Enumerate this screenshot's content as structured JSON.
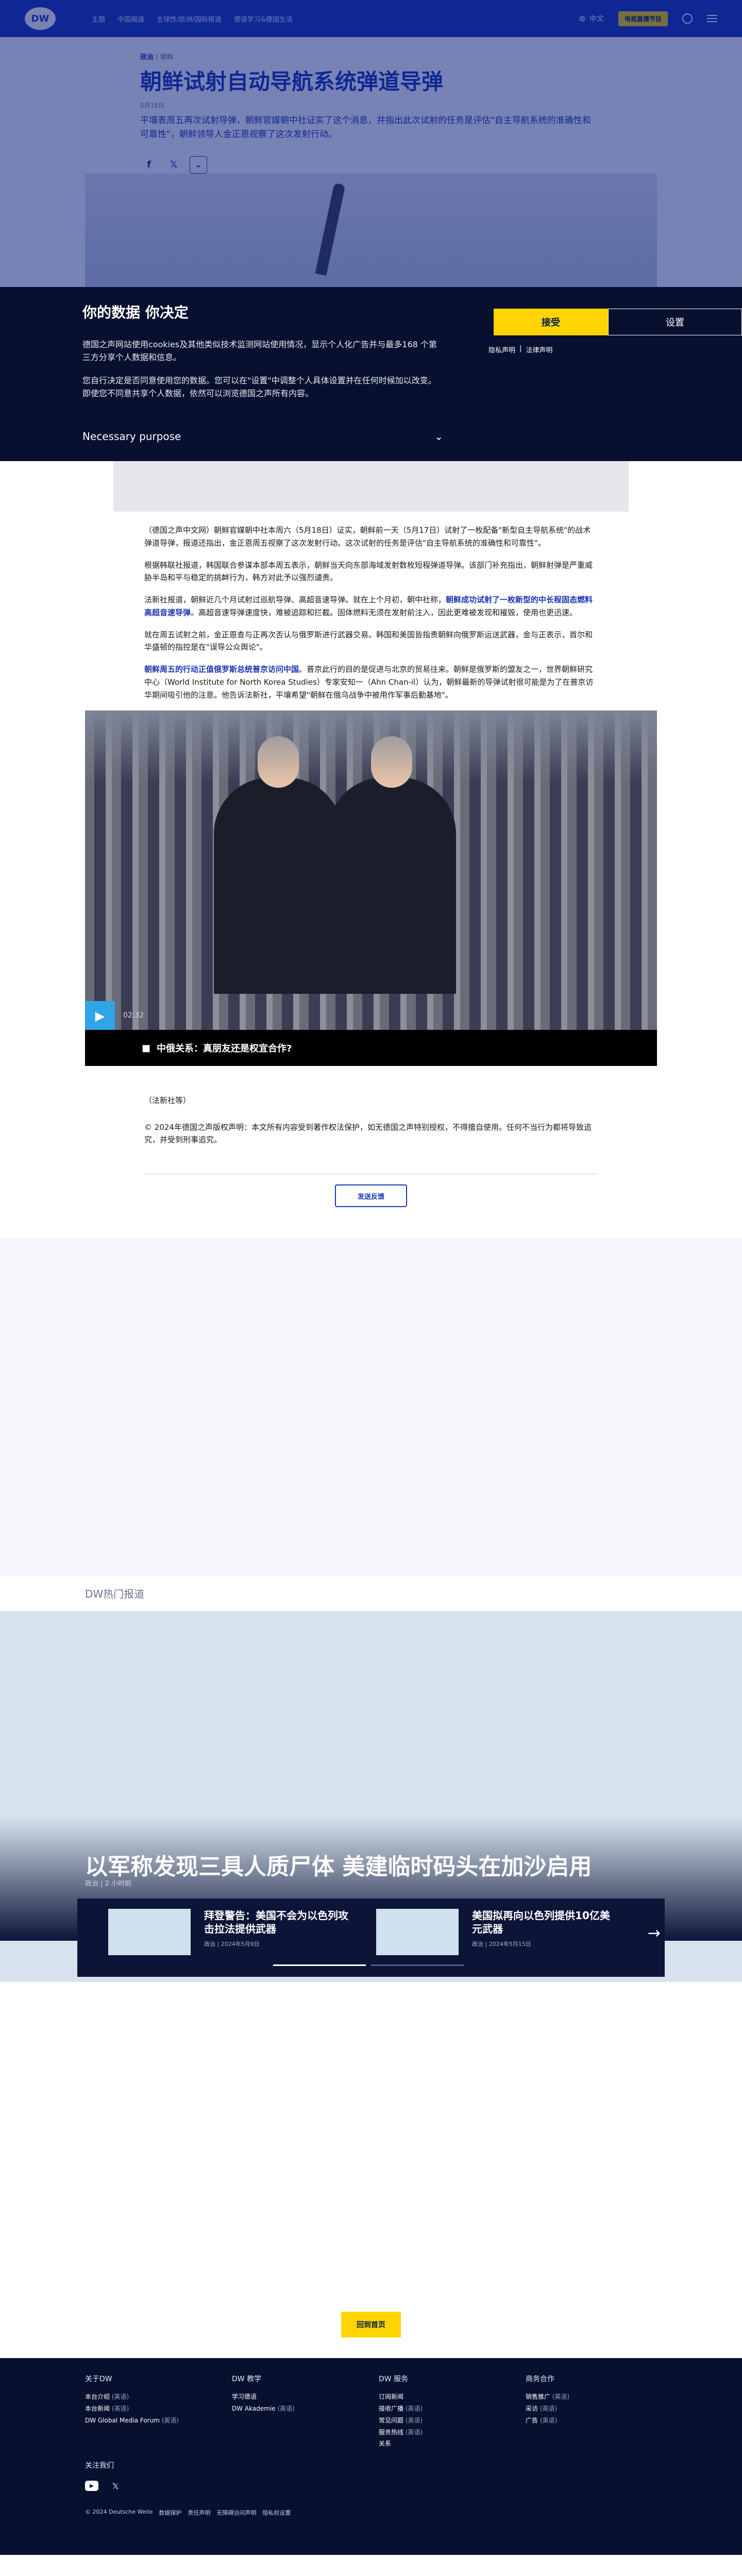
{
  "header": {
    "logo": "DW",
    "nav": [
      "主题",
      "中国报道",
      "全球性/欧洲/国际报道",
      "德语学习&德国生活"
    ],
    "language_link": "中文",
    "live_tv": "电视直播节目"
  },
  "article": {
    "category": "政治",
    "subcategory": "朝鲜",
    "title": "朝鲜试射自动导航系统弹道导弹",
    "date": "5月18日",
    "lead": "平壤表周五再次试射导弹，朝鲜官媒朝中社证实了这个消息，并指出此次试射的任务是评估\"自主导航系统的准确性和可靠性\"，朝鲜领导人金正恩视察了这次发射行动。",
    "share": {
      "facebook": "f",
      "x": "𝕏",
      "more": "⌄"
    },
    "paragraphs": [
      {
        "text": "（德国之声中文网）朝鲜官媒朝中社本周六（5月18日）证实，朝鲜前一天（5月17日）试射了一枚配备\"新型自主导航系统\"的战术弹道导弹，报道还指出，金正恩周五视察了这次发射行动。这次试射的任务是评估\"自主导航系统的准确性和可靠性\"。",
        "link": ""
      },
      {
        "text": "根据韩联社报道，韩国联合参谋本部本周五表示，朝鲜当天向东部海域发射数枚短程弹道导弹。该部门补充指出，朝鲜射弹是严重威胁半岛和平与稳定的挑衅行为，韩方对此予以强烈谴责。",
        "link": ""
      },
      {
        "text": "法新社报道，朝鲜近几个月试射过巡航导弹、高超音速导弹。就在上个月初，朝中社称，",
        "link": "朝鲜成功试射了一枚新型的中长程固态燃料高超音速导弹",
        "after": "。高超音速导弹速度快，难被追踪和拦截。固体燃料无须在发射前注入，因此更难被发现和摧毁，使用也更迅速。"
      },
      {
        "text": "就在周五试射之前，金正恩查与正再次否认与俄罗斯进行武器交易。韩国和美国皆指责朝鲜向俄罗斯运送武器，金与正表示，首尔和华盛顿的指控是在\"误导公众舆论\"。",
        "link": ""
      },
      {
        "text": "",
        "link": "朝鲜周五的行动正值俄罗斯总统普京访问中国",
        "after": "。普京此行的目的是促进与北京的贸易往来。朝鲜是俄罗斯的盟友之一，世界朝鲜研究中心（World Institute for North Korea Studies）专家安知一（Ahn Chan-il）认为，朝鲜最新的导弹试射很可能是为了在普京访华期间吸引他的注意。他告诉法新社，平壤希望\"朝鲜在俄乌战争中被用作军事后勤基地\"。"
      }
    ],
    "video": {
      "time": "02:32",
      "caption": "中俄关系：真朋友还是权宜合作?"
    },
    "source": "（法新社等）",
    "copyright": "© 2024年德国之声版权声明：本文所有内容受到著作权法保护，如无德国之声特别授权，不得擅自使用。任何不当行为都将导致追究，并受到刑事追究。",
    "feedback": "发送反馈"
  },
  "consent": {
    "title": "你的数据 你决定",
    "p1": "德国之声网站使用cookies及其他类似技术监测网站使用情况，显示个人化广告并与最多168 个第三方分享个人数据和信息。",
    "p2": "您自行决定是否同意使用您的数据。您可以在\"设置\"中调整个人具体设置并在任何时候加以改变。即使您不同意共享个人数据，依然可以浏览德国之声所有内容。",
    "purpose": "Necessary purpose",
    "accept": "接受",
    "settings": "设置",
    "privacy": "隐私声明",
    "legal": "法律声明"
  },
  "trending": {
    "label": "DW热门报道",
    "main_title": "以军称发现三具人质尸体 美建临时码头在加沙启用",
    "main_meta": "政治 | 2 小时前",
    "cards": [
      {
        "title": "拜登警告：美国不会为以色列攻击拉法提供武器",
        "meta": "政治 | 2024年5月9日"
      },
      {
        "title": "美国拟再向以色列提供10亿美元武器",
        "meta": "政治 | 2024年5月15日"
      }
    ]
  },
  "home_button": "回到首页",
  "footer": {
    "cols": [
      {
        "title": "关于DW",
        "items": [
          {
            "label": "本台介绍",
            "note": "(英语)"
          },
          {
            "label": "本台新闻",
            "note": "(英语)"
          },
          {
            "label": "DW Global Media Forum",
            "note": "(英语)"
          }
        ]
      },
      {
        "title": "DW 教学",
        "items": [
          {
            "label": "学习德语",
            "note": ""
          },
          {
            "label": "DW Akademie",
            "note": "(英语)"
          }
        ]
      },
      {
        "title": "DW 服务",
        "items": [
          {
            "label": "订阅新闻",
            "note": ""
          },
          {
            "label": "接收广播",
            "note": "(英语)"
          },
          {
            "label": "常见问题",
            "note": "(英语)"
          },
          {
            "label": "服务热线",
            "note": "(英语)"
          },
          {
            "label": "关系",
            "note": ""
          }
        ]
      },
      {
        "title": "商务合作",
        "items": [
          {
            "label": "销售推广",
            "note": "(英语)"
          },
          {
            "label": "采访",
            "note": "(英语)"
          },
          {
            "label": "广告",
            "note": "(英语)"
          }
        ]
      }
    ],
    "follow": "关注我们",
    "legal": [
      "© 2024 Deutsche Welle",
      "数据保护",
      "责任声明",
      "无障碍访问声明",
      "隐私权设置"
    ]
  }
}
